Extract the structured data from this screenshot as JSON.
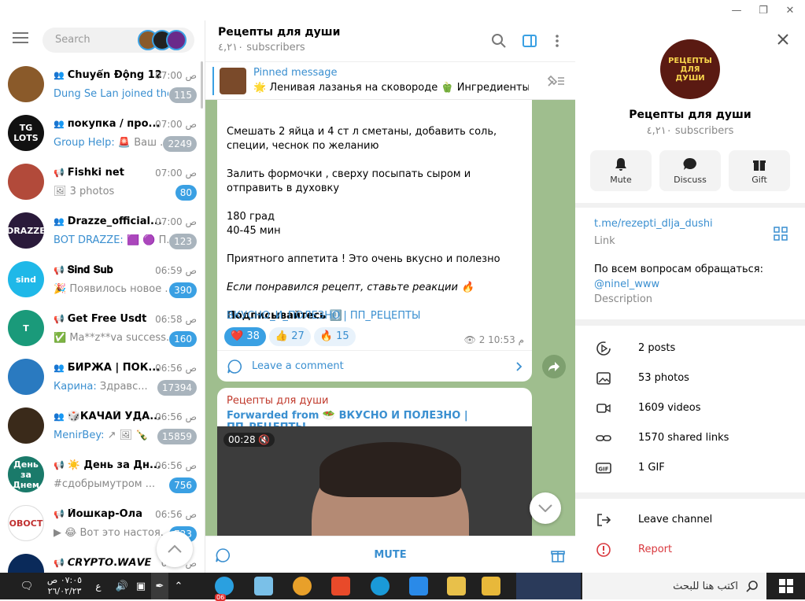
{
  "window": {
    "buttons": [
      "minimize",
      "restore",
      "close"
    ]
  },
  "left": {
    "search_placeholder": "Search",
    "chats": [
      {
        "title": "Chuyển Động 12h",
        "type": "group",
        "time": "ص 07:00",
        "author": "Dung Se Lan joined the...",
        "preview": "",
        "badge": "115",
        "badge_style": "grey",
        "avatar_color": "#8a5a2a",
        "avatar_text": ""
      },
      {
        "title": "покупка / про...",
        "type": "group",
        "time": "ص 07:00",
        "author": "Group Help:",
        "preview": "🚨 Ваш ...",
        "badge": "2249",
        "badge_style": "grey",
        "avatar_color": "#111111",
        "avatar_text": "TG LOTS"
      },
      {
        "title": "Fishki net",
        "type": "channel",
        "time": "ص 07:00",
        "author": "",
        "preview": "🖼 3 photos",
        "badge": "80",
        "badge_style": "blue",
        "avatar_color": "#b24a3a",
        "avatar_text": ""
      },
      {
        "title": "Drazze_official...",
        "type": "group",
        "time": "ص 07:00",
        "author": "BOT DRAZZE:",
        "preview": "🟪 🟣 П...",
        "badge": "123",
        "badge_style": "grey",
        "avatar_color": "#2a1a3a",
        "avatar_text": "DRAZZE"
      },
      {
        "title": "𝐒𝐢𝐧𝐝 𝐒𝐮𝐛",
        "type": "channel",
        "time": "ص 06:59",
        "author": "",
        "preview": "🎉 Появилось новое ...",
        "badge": "390",
        "badge_style": "blue",
        "avatar_color": "#1fb8e8",
        "avatar_text": "sind"
      },
      {
        "title": "Get Free Usdt",
        "type": "channel",
        "time": "ص 06:58",
        "author": "",
        "preview": "✅ Ma**z**va success...",
        "badge": "160",
        "badge_style": "blue",
        "avatar_color": "#1a9a7a",
        "avatar_text": "T"
      },
      {
        "title": "БИРЖА | ПОК...",
        "type": "group",
        "time": "ص 06:56",
        "author": "Карина:",
        "preview": "Здравс...",
        "badge": "17394",
        "badge_style": "grey",
        "avatar_color": "#2a7ac0",
        "avatar_text": ""
      },
      {
        "title": "🎲КАЧАЙ УДА...",
        "type": "group",
        "time": "ص 06:56",
        "author": "MenirBey:",
        "preview": "↗ 🖼 🍾",
        "badge": "15859",
        "badge_style": "grey",
        "avatar_color": "#3a2a1a",
        "avatar_text": ""
      },
      {
        "title": "☀️ День за Дн...",
        "type": "channel",
        "time": "ص 06:56",
        "author": "",
        "preview": "#сдобрымутром ...",
        "badge": "756",
        "badge_style": "blue",
        "avatar_color": "#1a7a6a",
        "avatar_text": "День за Днем"
      },
      {
        "title": "Йошкар-Ола",
        "type": "channel",
        "time": "ص 06:56",
        "author": "",
        "preview": "▶ 😂 Вот это настоя...",
        "badge": "723",
        "badge_style": "blue",
        "avatar_color": "#ffffff",
        "avatar_text": "НОВОСТИ"
      },
      {
        "title": "𝘾𝙍𝙔𝙋𝙏𝙊.𝙒𝘼𝙑𝙀",
        "type": "channel",
        "time": "ص 06:5",
        "author": "",
        "preview": "",
        "badge": "",
        "badge_style": "blue",
        "avatar_color": "#0a2a5a",
        "avatar_text": ""
      }
    ]
  },
  "middle": {
    "title": "Рецепты для души",
    "subscribers": "٤,٢١٠ subscribers",
    "pinned_label": "Pinned message",
    "pinned_text": "🌟 Ленивая лазанья на сковороде 🫑 Ингредиенты: ...",
    "message_lines": [
      "Смешать 2 яйца и 4 ст л сметаны, добавить соль, специи, чеснок по желанию",
      "Залить формочки , сверху посыпать сыром и отправить в духовку",
      "180 град\n40-45 мин",
      "Приятного аппетита ! Это очень вкусно и полезно"
    ],
    "message_italic": "Если понравился рецепт, ставьте реакции 🔥",
    "subscribe_text": "Подписывайтесь ⤵️",
    "tags": "ВКУСНО_И_ПОЛЕЗНО | ПП_РЕЦЕПТЫ",
    "reactions": [
      {
        "emoji": "❤️",
        "count": "38",
        "active": true
      },
      {
        "emoji": "👍",
        "count": "27",
        "active": false
      },
      {
        "emoji": "🔥",
        "count": "15",
        "active": false
      }
    ],
    "views": "2",
    "msg_time": "م 10:53",
    "comment_label": "Leave a comment",
    "msg2_author": "Рецепты для души",
    "msg2_forward": "Forwarded from 🥗 ВКУСНО И ПОЛЕЗНО | ПП_РЕЦЕПТЫ",
    "video_time": "00:28",
    "mute_label": "MUTE"
  },
  "right": {
    "avatar_text": [
      "РЕЦЕПТЫ",
      "ДЛЯ",
      "ДУШИ"
    ],
    "name": "Рецепты для души",
    "subscribers": "٤,٢١٠ subscribers",
    "buttons": [
      "Mute",
      "Discuss",
      "Gift"
    ],
    "link": "t.me/rezepti_dlja_dushi",
    "link_label": "Link",
    "description": "По всем вопросам обращаться:",
    "description_user": "@ninel_www",
    "description_label": "Description",
    "media": [
      "2 posts",
      "53 photos",
      "1609 videos",
      "1570 shared links",
      "1 GIF"
    ],
    "leave": "Leave channel",
    "report": "Report",
    "report_color": "#d9383e"
  },
  "taskbar": {
    "search_placeholder": "اكتب هنا للبحث",
    "time": "٠٧:٠٥ ص",
    "date": "٢٦/٠٢/٢٣",
    "lang": "ع",
    "telegram_badge": "06"
  }
}
